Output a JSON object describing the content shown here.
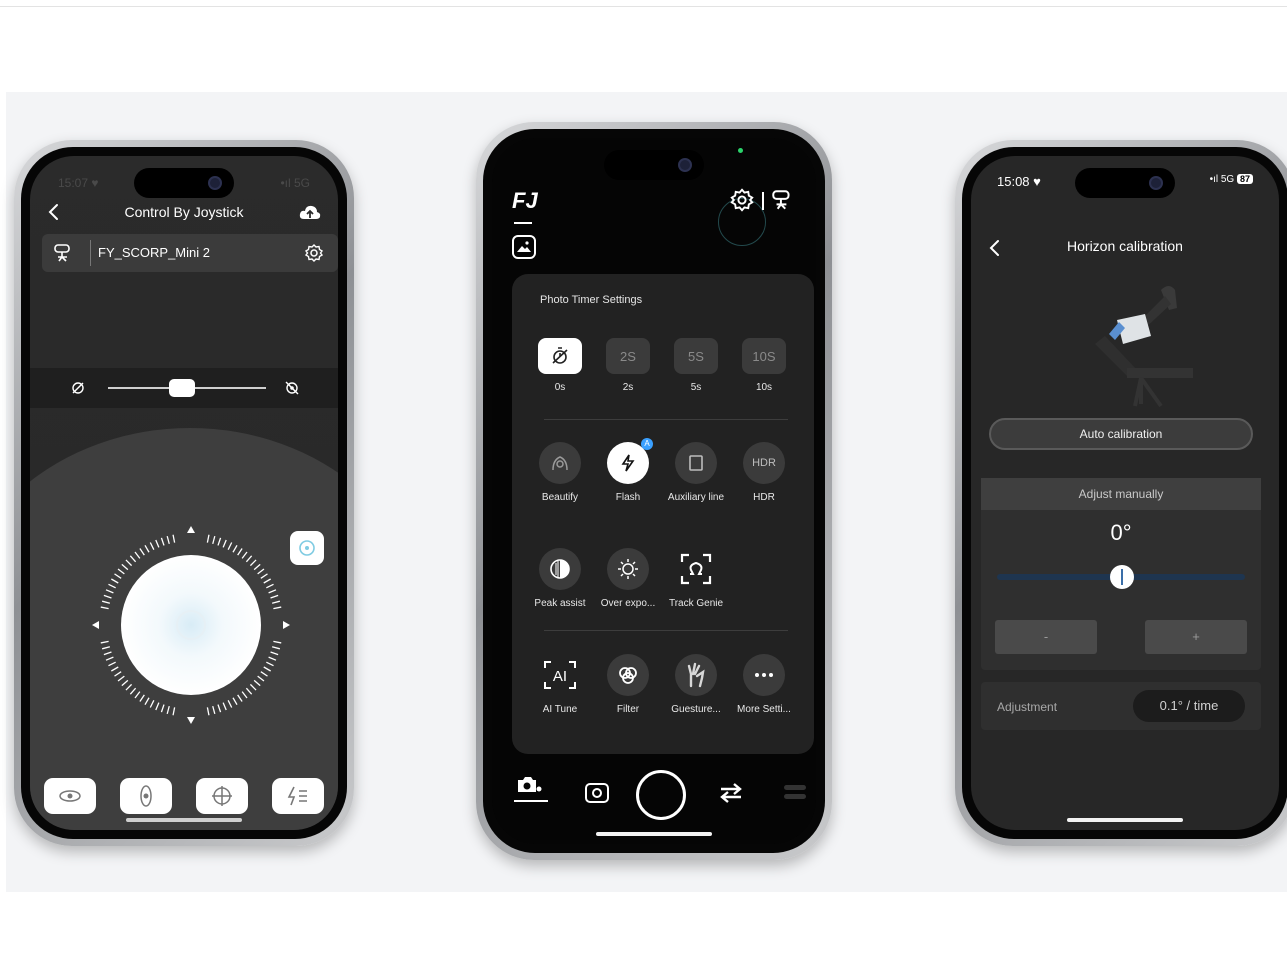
{
  "phone1": {
    "status_time": "15:07 ♥",
    "status_right": "•ıl 5G",
    "title": "Control By Joystick",
    "device_name": "FY_SCORP_Mini 2",
    "icons": {
      "back": "chevron-left-icon",
      "cloud": "cloud-upload-icon",
      "gimbal": "gimbal-icon",
      "settings": "gear-icon",
      "slider_left": "speed-slow-icon",
      "slider_right": "speed-fast-icon",
      "joystick": "joystick-icon",
      "side": "recenter-icon"
    },
    "slider_value_fraction": 0.47,
    "bottom_buttons": [
      "pan-follow-icon",
      "tilt-follow-icon",
      "fpv-mode-icon",
      "menu-more-icon"
    ]
  },
  "phone2": {
    "logo": "FJ",
    "panel_title": "Photo Timer Settings",
    "timer_options": [
      {
        "text": "",
        "label": "0s",
        "active": true
      },
      {
        "text": "2S",
        "label": "2s",
        "active": false
      },
      {
        "text": "5S",
        "label": "5s",
        "active": false
      },
      {
        "text": "10S",
        "label": "10s",
        "active": false
      }
    ],
    "row2": [
      {
        "label": "Beautify",
        "icon": "beautify-icon"
      },
      {
        "label": "Flash",
        "icon": "flash-icon",
        "active": true,
        "badge": "A"
      },
      {
        "label": "Auxiliary line",
        "icon": "grid-icon"
      },
      {
        "label": "HDR",
        "text": "HDR",
        "icon": "hdr-icon"
      }
    ],
    "row3": [
      {
        "label": "Peak assist",
        "icon": "peak-assist-icon"
      },
      {
        "label": "Over expo...",
        "icon": "sun-icon"
      },
      {
        "label": "Track Genie",
        "icon": "track-genie-icon"
      }
    ],
    "row4": [
      {
        "label": "AI Tune",
        "icon": "ai-tune-icon"
      },
      {
        "label": "Filter",
        "icon": "filter-icon"
      },
      {
        "label": "Guesture...",
        "icon": "gesture-icon"
      },
      {
        "label": "More Setti...",
        "icon": "more-icon"
      }
    ],
    "bottom_bar": [
      "camera-mode-icon",
      "photo-icon",
      "shutter-button",
      "switch-camera-icon",
      "toggle-icon"
    ],
    "accent": "#2bd36b"
  },
  "phone3": {
    "status_time": "15:08 ♥",
    "status_signal": "•ıl 5G",
    "battery": "87",
    "title": "Horizon calibration",
    "auto_button": "Auto calibration",
    "manual_header": "Adjust manually",
    "angle": "0°",
    "minus": "-",
    "plus": "+",
    "adjust_label": "Adjustment",
    "adjust_value": "0.1° / time",
    "track_color": "#1e3550"
  }
}
